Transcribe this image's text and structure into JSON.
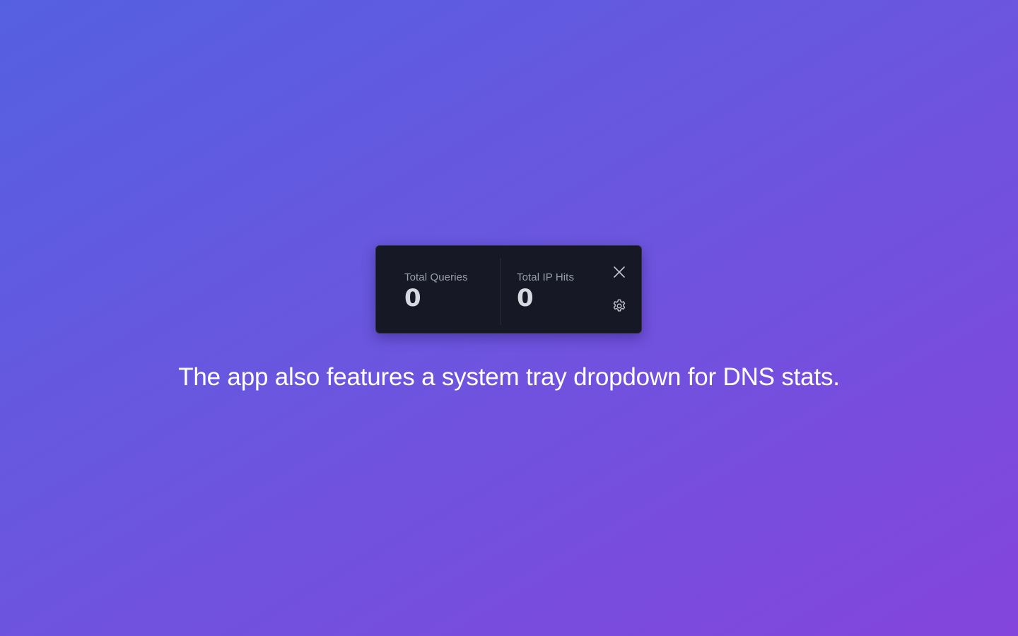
{
  "tray": {
    "stats": [
      {
        "label": "Total Queries",
        "value": "0"
      },
      {
        "label": "Total IP Hits",
        "value": "0"
      }
    ],
    "actions": {
      "close_icon": "close-icon",
      "settings_icon": "gear-icon"
    }
  },
  "caption": "The app also features a system tray dropdown for DNS stats.",
  "colors": {
    "card_background": "#161925",
    "label_text": "#9a9dab",
    "value_text": "#d7d9e0",
    "caption_text": "#ffffff"
  }
}
